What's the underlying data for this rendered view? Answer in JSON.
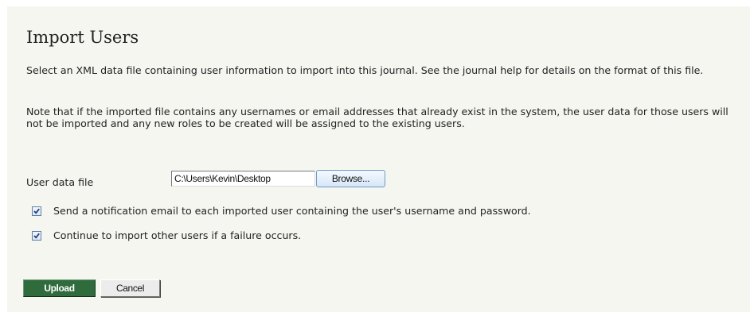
{
  "page": {
    "title": "Import Users",
    "intro_text": "Select an XML data file containing user information to import into this journal. See the journal help for details on the format of this file.",
    "note_text": "Note that if the imported file contains any usernames or email addresses that already exist in the system, the user data for those users will not be imported and any new roles to be created will be assigned to the existing users."
  },
  "form": {
    "file_label": "User data file",
    "file_value": "C:\\Users\\Kevin\\Desktop",
    "browse_label": "Browse...",
    "options": [
      {
        "label": "Send a notification email to each imported user containing the user's username and password.",
        "checked": true
      },
      {
        "label": "Continue to import other users if a failure occurs.",
        "checked": true
      }
    ]
  },
  "actions": {
    "upload_label": "Upload",
    "cancel_label": "Cancel"
  },
  "colors": {
    "panel_background": "#f6f6f1",
    "primary_button": "#2f6b3d"
  }
}
